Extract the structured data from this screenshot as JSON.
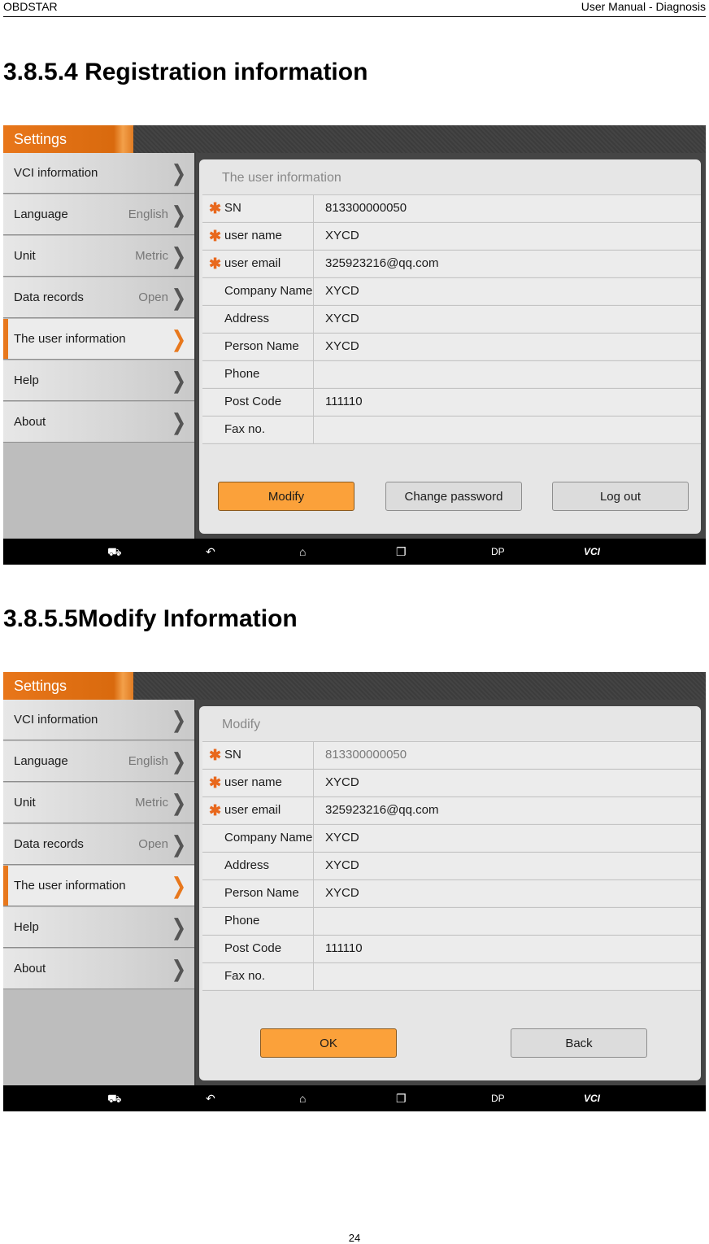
{
  "header": {
    "left": "OBDSTAR",
    "right": "User Manual - Diagnosis"
  },
  "section1": {
    "title": "3.8.5.4     Registration information"
  },
  "section2": {
    "title": "3.8.5.5Modify Information"
  },
  "footer": {
    "page_number": "24"
  },
  "colors": {
    "accent_orange": "#e8781d",
    "button_orange": "#fba13a"
  },
  "screens": [
    {
      "settings_tab": "Settings",
      "sidebar": [
        {
          "label": "VCI information",
          "value": ""
        },
        {
          "label": "Language",
          "value": "English"
        },
        {
          "label": "Unit",
          "value": "Metric"
        },
        {
          "label": "Data records",
          "value": "Open"
        },
        {
          "label": "The user information",
          "value": "",
          "active": true
        },
        {
          "label": "Help",
          "value": ""
        },
        {
          "label": "About",
          "value": ""
        }
      ],
      "card_title": "The user information",
      "fields": [
        {
          "label": "SN",
          "value": "813300000050",
          "required": true
        },
        {
          "label": "user name",
          "value": "XYCD",
          "required": true
        },
        {
          "label": "user email",
          "value": "325923216@qq.com",
          "required": true
        },
        {
          "label": "Company Name",
          "value": "XYCD"
        },
        {
          "label": "Address",
          "value": "XYCD"
        },
        {
          "label": "Person Name",
          "value": "XYCD"
        },
        {
          "label": "Phone",
          "value": ""
        },
        {
          "label": "Post Code",
          "value": "111110"
        },
        {
          "label": "Fax no.",
          "value": ""
        }
      ],
      "buttons": {
        "modify": "Modify",
        "change_password": "Change password",
        "log_out": "Log out"
      },
      "navbar": {
        "dp": "DP",
        "vci": "VCI"
      }
    },
    {
      "settings_tab": "Settings",
      "sidebar": [
        {
          "label": "VCI information",
          "value": ""
        },
        {
          "label": "Language",
          "value": "English"
        },
        {
          "label": "Unit",
          "value": "Metric"
        },
        {
          "label": "Data records",
          "value": "Open"
        },
        {
          "label": "The user information",
          "value": "",
          "active": true
        },
        {
          "label": "Help",
          "value": ""
        },
        {
          "label": "About",
          "value": ""
        }
      ],
      "card_title": "Modify",
      "fields": [
        {
          "label": "SN",
          "value": "813300000050",
          "required": true
        },
        {
          "label": "user name",
          "value": "XYCD",
          "required": true
        },
        {
          "label": "user email",
          "value": "325923216@qq.com",
          "required": true
        },
        {
          "label": "Company Name",
          "value": "XYCD"
        },
        {
          "label": "Address",
          "value": "XYCD"
        },
        {
          "label": "Person Name",
          "value": "XYCD"
        },
        {
          "label": "Phone",
          "value": ""
        },
        {
          "label": "Post Code",
          "value": "111110"
        },
        {
          "label": "Fax no.",
          "value": ""
        }
      ],
      "buttons": {
        "ok": "OK",
        "back": "Back"
      },
      "navbar": {
        "dp": "DP",
        "vci": "VCI"
      }
    }
  ]
}
